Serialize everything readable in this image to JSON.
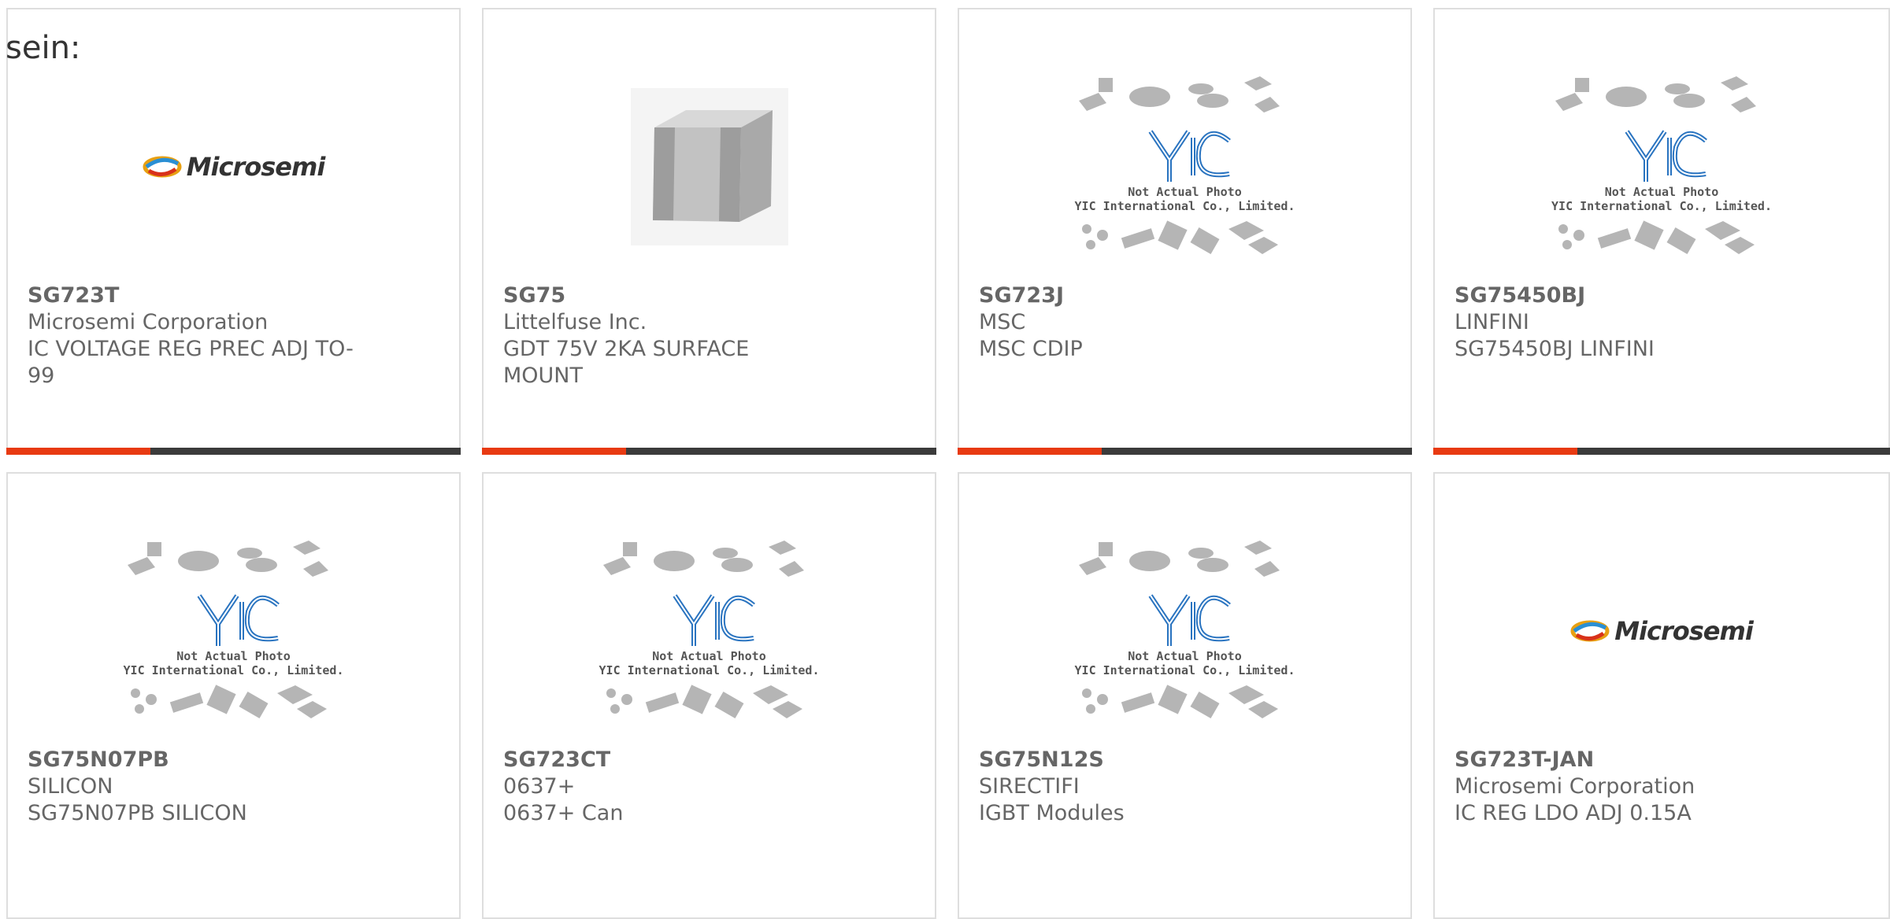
{
  "intro_text": "sein:",
  "colors": {
    "accent": "#e83a12",
    "bar": "#3b3b3b",
    "border": "#dedede",
    "text": "#666666"
  },
  "cards": [
    {
      "part": "SG723T",
      "maker": "Microsemi Corporation",
      "desc": "IC VOLTAGE REG PREC ADJ TO-99",
      "image": "microsemi-logo",
      "image_text": "Microsemi"
    },
    {
      "part": "SG75",
      "maker": "Littelfuse Inc.",
      "desc": "GDT 75V 2KA SURFACE MOUNT",
      "image": "gdt-component-photo"
    },
    {
      "part": "SG723J",
      "maker": "MSC",
      "desc": "MSC CDIP",
      "image": "yic-placeholder",
      "image_caption_1": "Not Actual Photo",
      "image_caption_2": "YIC International Co., Limited."
    },
    {
      "part": "SG75450BJ",
      "maker": "LINFINI",
      "desc": "SG75450BJ LINFINI",
      "image": "yic-placeholder",
      "image_caption_1": "Not Actual Photo",
      "image_caption_2": "YIC International Co., Limited."
    },
    {
      "part": "SG75N07PB",
      "maker": "SILICON",
      "desc": "SG75N07PB SILICON",
      "image": "yic-placeholder",
      "image_caption_1": "Not Actual Photo",
      "image_caption_2": "YIC International Co., Limited."
    },
    {
      "part": "SG723CT",
      "maker": "0637+",
      "desc": "0637+ Can",
      "image": "yic-placeholder",
      "image_caption_1": "Not Actual Photo",
      "image_caption_2": "YIC International Co., Limited."
    },
    {
      "part": "SG75N12S",
      "maker": "SIRECTIFI",
      "desc": "IGBT Modules",
      "image": "yic-placeholder",
      "image_caption_1": "Not Actual Photo",
      "image_caption_2": "YIC International Co., Limited."
    },
    {
      "part": "SG723T-JAN",
      "maker": "Microsemi Corporation",
      "desc": "IC REG LDO ADJ 0.15A",
      "image": "microsemi-logo",
      "image_text": "Microsemi"
    }
  ]
}
